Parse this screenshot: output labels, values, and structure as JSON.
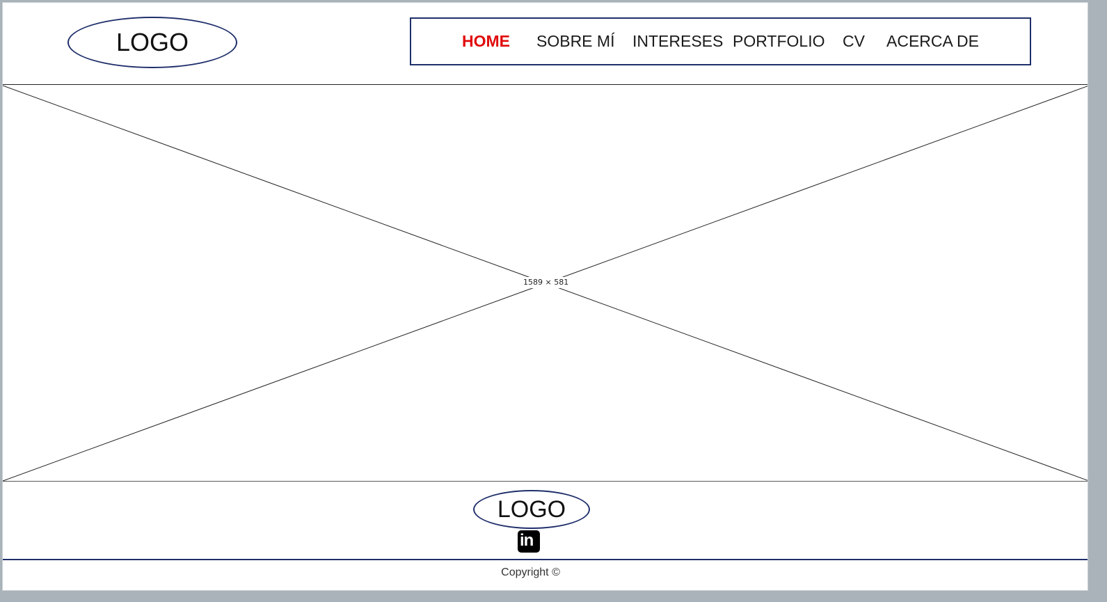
{
  "header": {
    "logo_text": "LOGO"
  },
  "nav": {
    "items": [
      {
        "label": "HOME",
        "active": true
      },
      {
        "label": "SOBRE MÍ",
        "active": false
      },
      {
        "label": "INTERESES",
        "active": false
      },
      {
        "label": "PORTFOLIO",
        "active": false
      },
      {
        "label": "CV",
        "active": false
      },
      {
        "label": "ACERCA DE",
        "active": false
      }
    ]
  },
  "hero": {
    "placeholder_dimensions": "1589 × 581"
  },
  "footer": {
    "logo_text": "LOGO",
    "social_icon": "linkedin-icon",
    "copyright": "Copyright ©"
  },
  "colors": {
    "accent_active": "#e10b0b",
    "border_navy": "#1f2f6b",
    "text": "#1a1a1a"
  }
}
